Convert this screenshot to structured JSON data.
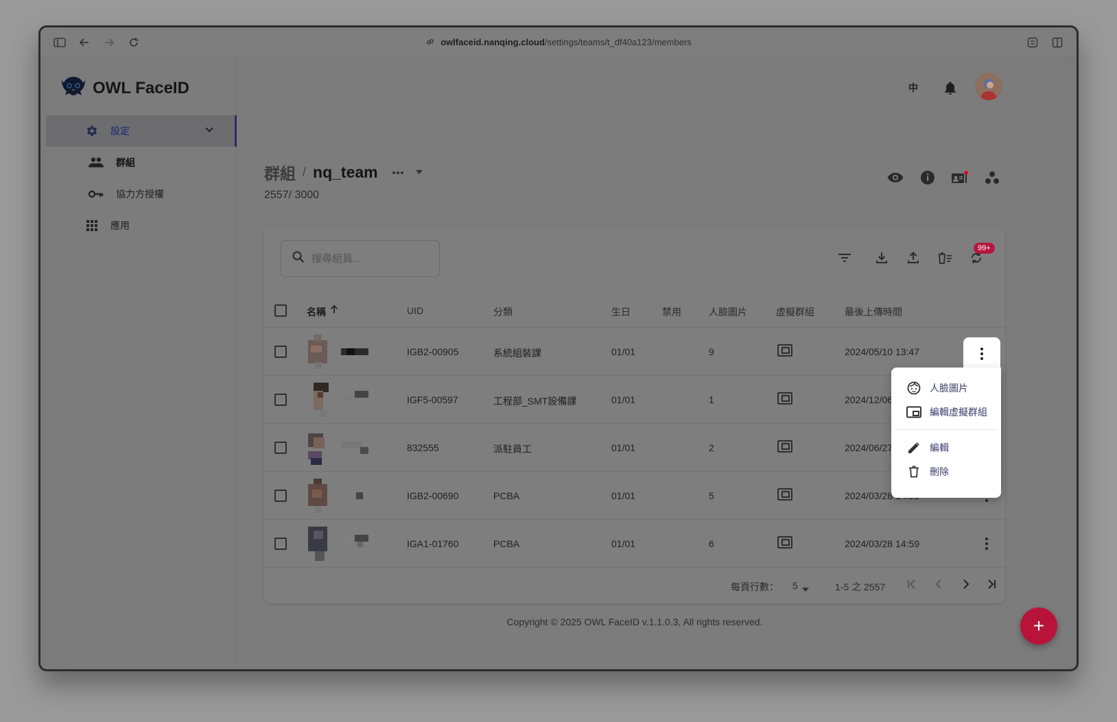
{
  "browser": {
    "url_host": "owlfaceid.nanqing.cloud",
    "url_path": "/settings/teams/t_df40a123/members"
  },
  "brand": {
    "name": "OWL FaceID"
  },
  "sidebar": {
    "items": [
      {
        "label": "設定",
        "icon": "gear-icon",
        "active": true
      },
      {
        "label": "群組",
        "icon": "people-icon"
      },
      {
        "label": "協力方授權",
        "icon": "key-icon"
      },
      {
        "label": "應用",
        "icon": "apps-grid-icon"
      }
    ]
  },
  "topbar": {
    "lang": "中"
  },
  "breadcrumb": {
    "parent": "群組",
    "separator": "/",
    "current": "nq_team"
  },
  "member_count": "2557/ 3000",
  "search": {
    "placeholder": "搜尋組員..."
  },
  "notification_badge": "99+",
  "table": {
    "headers": {
      "name": "名稱",
      "uid": "UID",
      "category": "分類",
      "birthday": "生日",
      "disabled": "禁用",
      "face_images": "人臉圖片",
      "virtual_group": "虛擬群組",
      "last_upload": "最後上傳時間"
    },
    "rows": [
      {
        "uid": "IGB2-00905",
        "category": "系統組裝課",
        "birthday": "01/01",
        "faces": "9",
        "last_upload": "2024/05/10 13:47"
      },
      {
        "uid": "IGF5-00597",
        "category": "工程部_SMT設備課",
        "birthday": "01/01",
        "faces": "1",
        "last_upload": "2024/12/06"
      },
      {
        "uid": "832555",
        "category": "派駐員工",
        "birthday": "01/01",
        "faces": "2",
        "last_upload": "2024/06/27"
      },
      {
        "uid": "IGB2-00690",
        "category": "PCBA",
        "birthday": "01/01",
        "faces": "5",
        "last_upload": "2024/03/28 14:59"
      },
      {
        "uid": "IGA1-01760",
        "category": "PCBA",
        "birthday": "01/01",
        "faces": "6",
        "last_upload": "2024/03/28 14:59"
      }
    ]
  },
  "pagination": {
    "rows_per_page_label": "每頁行數：",
    "rows_per_page": "5",
    "range": "1-5 之 2557"
  },
  "context_menu": {
    "items": [
      "人臉圖片",
      "編輯虛擬群組",
      "編輯",
      "刪除"
    ]
  },
  "footer": {
    "copyright": "Copyright © 2025 OWL FaceID v.1.1.0.3, All rights reserved."
  },
  "fab": {
    "label": "+"
  },
  "colors": {
    "accent": "#b8143a",
    "nav_active": "#1c2473",
    "menu_text": "#3b3d6b"
  }
}
